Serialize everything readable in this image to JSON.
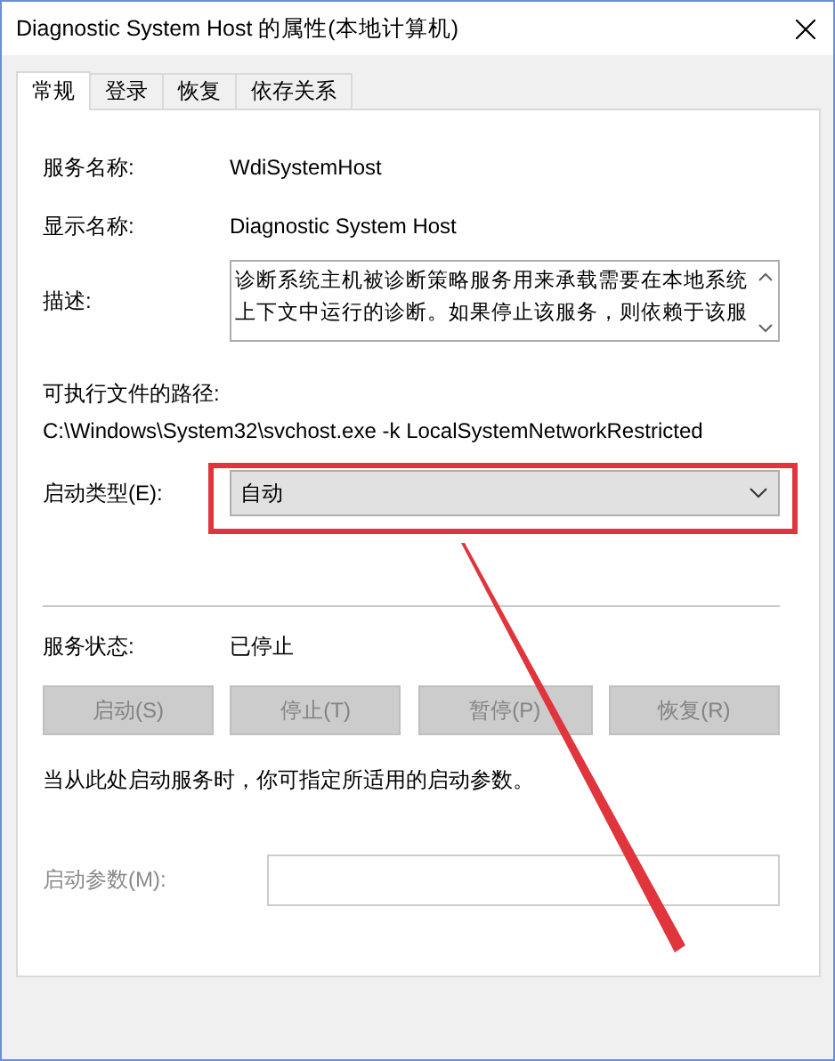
{
  "window": {
    "title": "Diagnostic System Host 的属性(本地计算机)"
  },
  "tabs": [
    {
      "label": "常规",
      "selected": true
    },
    {
      "label": "登录",
      "selected": false
    },
    {
      "label": "恢复",
      "selected": false
    },
    {
      "label": "依存关系",
      "selected": false
    }
  ],
  "service_name": {
    "label": "服务名称:",
    "value": "WdiSystemHost"
  },
  "display_name": {
    "label": "显示名称:",
    "value": "Diagnostic System Host"
  },
  "description": {
    "label": "描述:",
    "lines": [
      "诊断系统主机被诊断策略服务用来承载需要在本地系统",
      "上下文中运行的诊断。如果停止该服务，则依赖于该服"
    ]
  },
  "executable_path": {
    "label": "可执行文件的路径:",
    "value": "C:\\Windows\\System32\\svchost.exe -k LocalSystemNetworkRestricted"
  },
  "startup_type": {
    "label": "启动类型(E):",
    "value": "自动"
  },
  "service_status": {
    "label": "服务状态:",
    "value": "已停止"
  },
  "buttons": [
    {
      "label": "启动(S)",
      "disabled": true
    },
    {
      "label": "停止(T)",
      "disabled": true
    },
    {
      "label": "暂停(P)",
      "disabled": true
    },
    {
      "label": "恢复(R)",
      "disabled": true
    }
  ],
  "note": "当从此处启动服务时，你可指定所适用的启动参数。",
  "start_parameters": {
    "label": "启动参数(M):",
    "disabled": true
  }
}
